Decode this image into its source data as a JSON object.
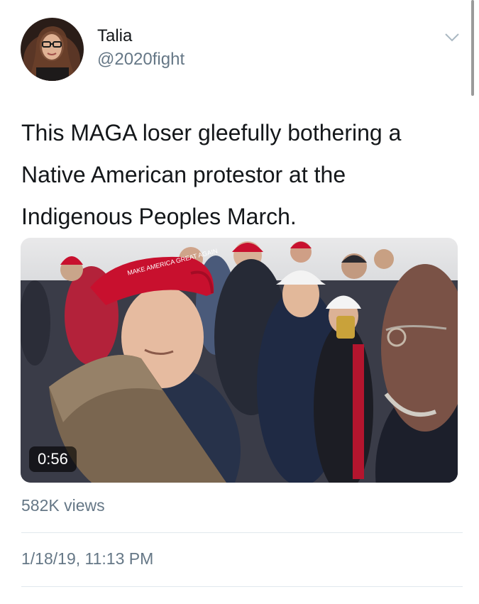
{
  "user": {
    "name": "Talia",
    "handle": "@2020fight",
    "avatar_icon": "profile-photo"
  },
  "tweet": {
    "text_lines": [
      "This MAGA loser gleefully bothering a",
      "Native American protestor at the",
      "Indigenous Peoples March."
    ]
  },
  "media": {
    "duration": "0:56",
    "hat_text": "MAKE AMERICA GREAT AGAIN"
  },
  "stats": {
    "views": "582K views"
  },
  "meta": {
    "timestamp": "1/18/19, 11:13 PM"
  },
  "icons": {
    "caret": "chevron-down-icon"
  },
  "colors": {
    "text": "#14171a",
    "secondary": "#657786",
    "divider": "#e1e8ed",
    "maga_red": "#c8102e"
  }
}
